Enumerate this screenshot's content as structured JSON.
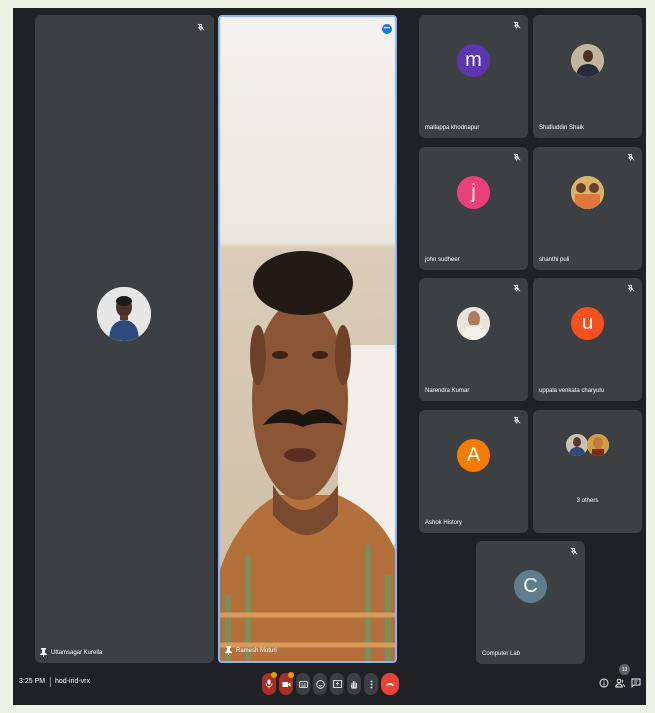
{
  "participants": {
    "left_main": {
      "name": "Uttamsagar Kurella"
    },
    "speaker": {
      "name": "Ramesh Moturi"
    },
    "grid": [
      {
        "name": "mallappa khodnapur",
        "initial": "m",
        "color": "#5e35b1"
      },
      {
        "name": "Shafiuddin Shaik",
        "initial": "",
        "color": "#9e9e9e"
      },
      {
        "name": "john sudheer",
        "initial": "j",
        "color": "#ec407a"
      },
      {
        "name": "shanthi puli",
        "initial": "",
        "color": "#c9a15a"
      },
      {
        "name": "Narendra Kumar",
        "initial": "",
        "color": "#8d6e63"
      },
      {
        "name": "uppala venkata charyulu",
        "initial": "u",
        "color": "#f4511e"
      },
      {
        "name": "Ashok History",
        "initial": "A",
        "color": "#f57c00"
      }
    ],
    "others": {
      "label": "3 others"
    },
    "computer_lab": {
      "name": "Computer Lab",
      "initial": "C",
      "color": "#607d8b"
    }
  },
  "bottom_bar": {
    "time": "3:25 PM",
    "meeting_code": "hod-irid-vrx",
    "participant_count": "13",
    "controls": [
      "mic-icon",
      "camera-icon",
      "captions-icon",
      "emoji-icon",
      "present-icon",
      "raise-hand-icon",
      "more-options-icon",
      "hang-up-icon"
    ],
    "right_controls": [
      "info-icon",
      "people-icon",
      "chat-icon"
    ]
  },
  "colors": {
    "background": "#202124",
    "tile": "#3c4043",
    "active_border": "#8ab4f8",
    "hang_up": "#ea4335"
  }
}
